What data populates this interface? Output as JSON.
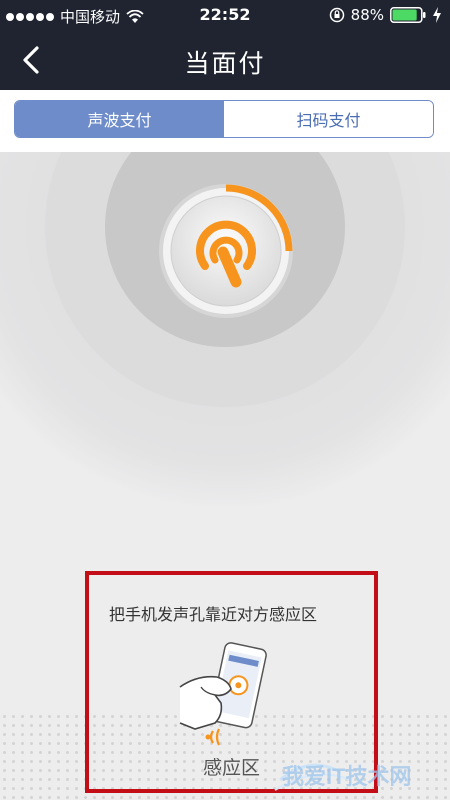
{
  "status_bar": {
    "carrier": "中国移动",
    "time": "22:52",
    "battery": "88%",
    "battery_level": 0.88
  },
  "nav": {
    "title": "当面付",
    "back_icon": "chevron-left-icon"
  },
  "tabs": [
    {
      "label": "声波支付",
      "active": true
    },
    {
      "label": "扫码支付",
      "active": false
    }
  ],
  "sonic": {
    "icon": "sonic-wave-icon",
    "progress": 0.25,
    "accent_color": "#f7941d"
  },
  "hint": {
    "text": "把手机发声孔靠近对方感应区",
    "sensor_label": "感应区",
    "illustration_icon": "hand-phone-icon"
  },
  "colors": {
    "header_bg": "#1f2430",
    "tab_active": "#6e8cc9",
    "highlight": "#c30d17"
  },
  "watermark": {
    "text": "我爱IT技术网"
  }
}
